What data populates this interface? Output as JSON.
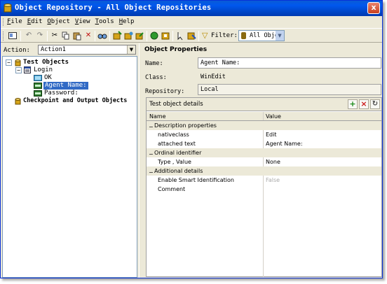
{
  "window": {
    "title": "Object Repository - All Object Repositories",
    "close_glyph": "x"
  },
  "menu": {
    "items": [
      {
        "key": "F",
        "rest": "ile"
      },
      {
        "key": "E",
        "rest": "dit"
      },
      {
        "key": "O",
        "rest": "bject"
      },
      {
        "key": "V",
        "rest": "iew"
      },
      {
        "key": "T",
        "rest": "ools"
      },
      {
        "key": "H",
        "rest": "elp"
      }
    ]
  },
  "toolbar": {
    "filter_label": "Filter:",
    "filter_value": "All Obje",
    "icons": [
      "layout-icon",
      "undo-icon",
      "redo-icon",
      "cut-icon",
      "copy-icon",
      "paste-icon",
      "delete-icon",
      "find-icon",
      "add-objects-icon",
      "update-icon",
      "export-icon",
      "merge-icon",
      "capture-icon",
      "highlight-icon",
      "locate-icon",
      "filter-icon"
    ]
  },
  "left": {
    "action_label": "Action:",
    "action_value": "Action1",
    "tree": {
      "root": "Test Objects",
      "dialog": "Login",
      "children": [
        "OK",
        "Agent Name:",
        "Password:"
      ],
      "checkpoints": "Checkpoint and Output Objects"
    }
  },
  "right": {
    "header": "Object Properties",
    "name_label": "Name:",
    "name_value": "Agent Name:",
    "class_label": "Class:",
    "class_value": "WinEdit",
    "repository_label": "Repository:",
    "repository_value": "Local",
    "details": {
      "title": "Test object details",
      "columns": [
        "Name",
        "Value"
      ],
      "groups": [
        {
          "name": "Description properties",
          "rows": [
            {
              "name": "nativeclass",
              "value": "Edit"
            },
            {
              "name": "attached text",
              "value": "Agent Name:"
            }
          ]
        },
        {
          "name": "Ordinal identifier",
          "rows": [
            {
              "name": "Type , Value",
              "value": "None"
            }
          ]
        },
        {
          "name": "Additional details",
          "rows": [
            {
              "name": "Enable Smart Identification",
              "value": "False"
            },
            {
              "name": "Comment",
              "value": ""
            }
          ]
        }
      ]
    }
  },
  "colors": {
    "title_bar": "#0058ee",
    "selection": "#316ac5",
    "add_green": "#1a8a1a",
    "delete_red": "#cc1a1a"
  }
}
